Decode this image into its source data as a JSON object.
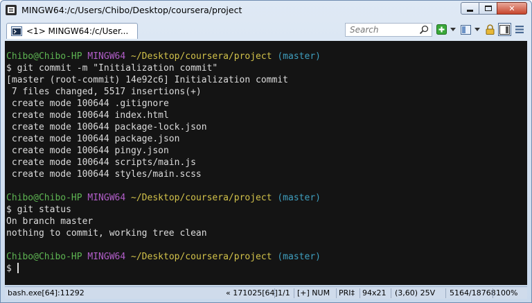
{
  "window": {
    "title": "MINGW64:/c/Users/Chibo/Desktop/coursera/project",
    "app_icon": "terminal-window-icon"
  },
  "toolbar": {
    "tab_label": "<1> MINGW64:/c/User...",
    "tab_icon": "console-icon",
    "search_placeholder": "Search",
    "icons": [
      "add-console-icon",
      "panel-layout-icon",
      "lock-icon",
      "view-toggle-icon",
      "menu-icon"
    ]
  },
  "terminal": {
    "colors": {
      "background": "#141414",
      "text": "#dcdcdc",
      "user": "#5eb552",
      "host": "#b25ec9",
      "path": "#d2c24a",
      "branch": "#3f9fbf"
    },
    "prompt1": {
      "user": "Chibo@Chibo-HP",
      "host": "MINGW64",
      "path": "~/Desktop/coursera/project",
      "branch": "(master)"
    },
    "lines_block1": [
      "$ git commit -m \"Initialization commit\"",
      "[master (root-commit) 14e92c6] Initialization commit",
      " 7 files changed, 5517 insertions(+)",
      " create mode 100644 .gitignore",
      " create mode 100644 index.html",
      " create mode 100644 package-lock.json",
      " create mode 100644 package.json",
      " create mode 100644 pingy.json",
      " create mode 100644 scripts/main.js",
      " create mode 100644 styles/main.scss"
    ],
    "prompt2": {
      "user": "Chibo@Chibo-HP",
      "host": "MINGW64",
      "path": "~/Desktop/coursera/project",
      "branch": "(master)"
    },
    "lines_block2": [
      "$ git status",
      "On branch master",
      "nothing to commit, working tree clean"
    ],
    "prompt3": {
      "user": "Chibo@Chibo-HP",
      "host": "MINGW64",
      "path": "~/Desktop/coursera/project",
      "branch": "(master)"
    },
    "input_prompt": "$ "
  },
  "statusbar": {
    "process": "bash.exe[64]:11292",
    "build": "« 171025[64]",
    "tab_index": "1/1",
    "modifiers": "[+] NUM",
    "priority": "PRI‡",
    "size": "94x21",
    "cursor_pos": "(3,60) 25V",
    "buffer": "5164/18768",
    "zoom": "100%"
  }
}
